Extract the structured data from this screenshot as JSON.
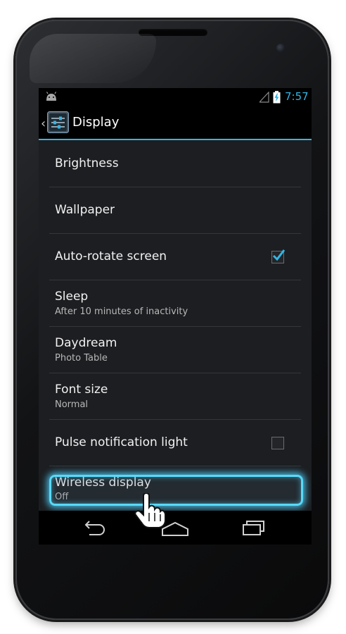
{
  "status_bar": {
    "time": "7:57",
    "icons": [
      "android-icon",
      "signal-icon",
      "battery-charging-icon"
    ],
    "accent_color": "#33b5e5"
  },
  "action_bar": {
    "title": "Display",
    "icons": [
      "up-caret-icon",
      "settings-sliders-icon"
    ]
  },
  "settings": [
    {
      "title": "Brightness"
    },
    {
      "title": "Wallpaper"
    },
    {
      "title": "Auto-rotate screen",
      "checkbox": true,
      "checked": true
    },
    {
      "title": "Sleep",
      "summary": "After 10 minutes of inactivity"
    },
    {
      "title": "Daydream",
      "summary": "Photo Table"
    },
    {
      "title": "Font size",
      "summary": "Normal"
    },
    {
      "title": "Pulse notification light",
      "checkbox": true,
      "checked": false
    },
    {
      "title": "Wireless display",
      "summary": "Off",
      "highlighted": true
    }
  ],
  "nav_bar": {
    "icons": [
      "back-icon",
      "home-icon",
      "recent-apps-icon"
    ]
  },
  "highlight_color": "#59d9f7"
}
